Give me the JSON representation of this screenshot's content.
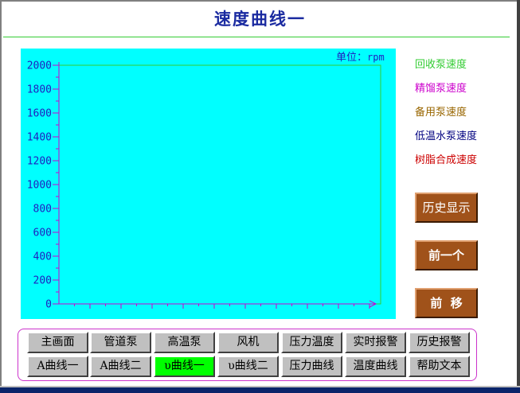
{
  "title": "速度曲线一",
  "unit_label": {
    "prefix": "单位：",
    "unit": "rpm"
  },
  "legend": [
    {
      "label": "回收泵速度",
      "color": "#33cc33"
    },
    {
      "label": "精馏泵速度",
      "color": "#cc00cc"
    },
    {
      "label": "备用泵速度",
      "color": "#996600"
    },
    {
      "label": "低温水泵速度",
      "color": "#000080"
    },
    {
      "label": "树脂合成速度",
      "color": "#cc0000"
    }
  ],
  "side_buttons": {
    "history": "历史显示",
    "previous": "前一个",
    "shift": "前  移"
  },
  "nav": {
    "row1": [
      "主画面",
      "管道泵",
      "高温泵",
      "风机",
      "压力温度",
      "实时报警",
      "历史报警"
    ],
    "row2": [
      "A曲线一",
      "A曲线二",
      "υ曲线一",
      "υ曲线二",
      "压力曲线",
      "温度曲线",
      "帮助文本"
    ],
    "active_label": "υ曲线一"
  },
  "colors": {
    "plot_bg": "#00ffff",
    "axis": "#cc00cc",
    "tick_label": "#2020c0",
    "plot_border": "#33cc33",
    "side_button": "#a0521a",
    "active_nav": "#00ff00"
  },
  "chart_data": {
    "type": "line",
    "series": [],
    "ylim": [
      0,
      2000
    ],
    "yticks": [
      0,
      200,
      400,
      600,
      800,
      1000,
      1200,
      1400,
      1600,
      1800,
      2000
    ],
    "ytick_labels": [
      "0",
      "200",
      "400",
      "600",
      "800",
      "1000",
      "1200",
      "1400",
      "1600",
      "1800",
      "2000"
    ],
    "x_major_ticks": 10,
    "ylabel": "单位：rpm",
    "grid": false
  }
}
